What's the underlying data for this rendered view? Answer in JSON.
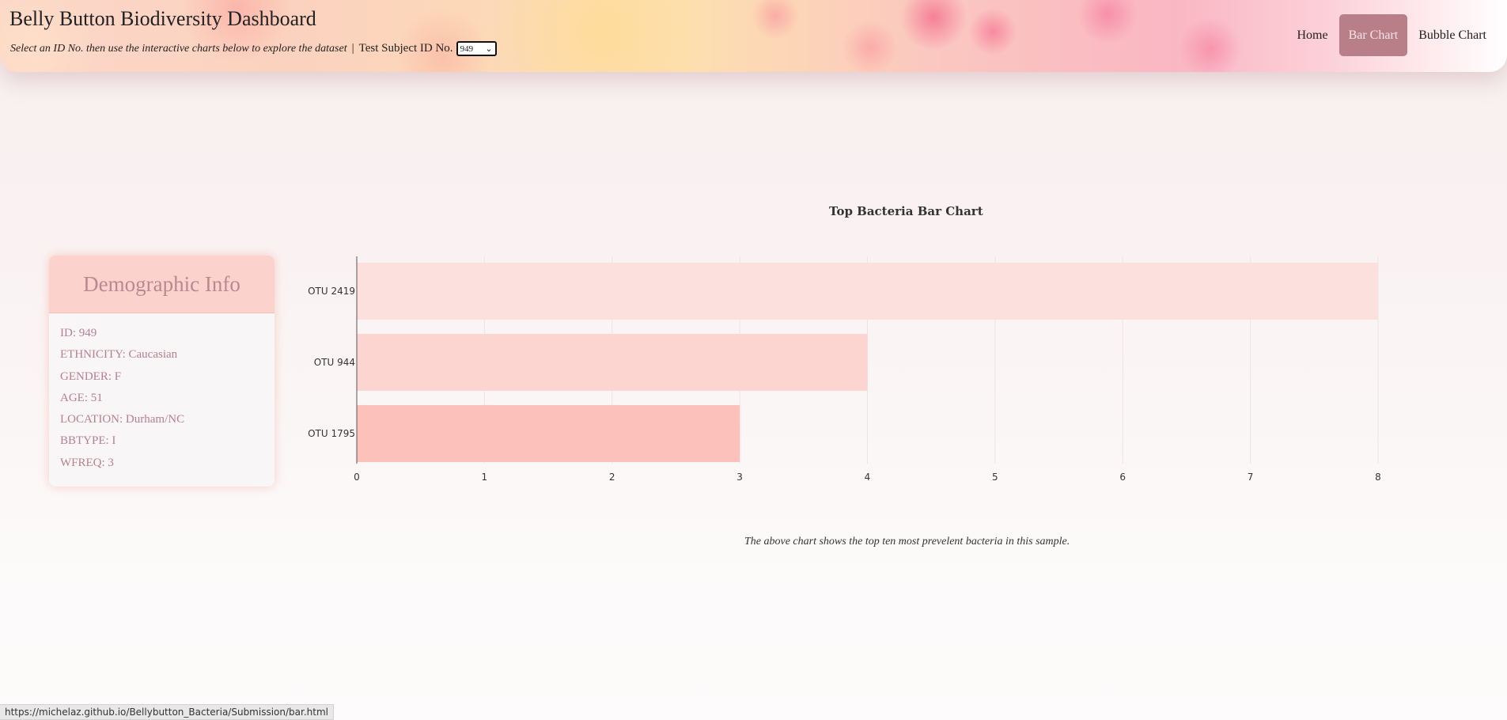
{
  "header": {
    "title": "Belly Button Biodiversity Dashboard",
    "instructions": "Select an ID No. then use the interactive charts below to explore the dataset",
    "separator": "|",
    "id_label": "Test Subject ID No.",
    "selected_id": "949"
  },
  "nav": {
    "items": [
      {
        "label": "Home",
        "active": false
      },
      {
        "label": "Bar Chart",
        "active": true
      },
      {
        "label": "Bubble Chart",
        "active": false
      }
    ]
  },
  "demographics": {
    "title": "Demographic Info",
    "lines": [
      "ID: 949",
      "ETHNICITY: Caucasian",
      "GENDER: F",
      "AGE: 51",
      "LOCATION: Durham/NC",
      "BBTYPE: I",
      "WFREQ: 3"
    ]
  },
  "chart_data": {
    "type": "bar",
    "orientation": "horizontal",
    "title": "Top Bacteria Bar Chart",
    "categories": [
      "OTU 2419",
      "OTU 944",
      "OTU 1795"
    ],
    "values": [
      8,
      4,
      3
    ],
    "colors": [
      "#fbe0dd",
      "#fcd5d0",
      "#fcc1bb"
    ],
    "xlim": [
      0,
      8
    ],
    "xticks": [
      0,
      1,
      2,
      3,
      4,
      5,
      6,
      7,
      8
    ],
    "grid": true
  },
  "caption": "The above chart shows the top ten most prevelent bacteria in this sample.",
  "status_bar": "https://michelaz.github.io/Bellybutton_Bacteria/Submission/bar.html",
  "colors": {
    "accent": "#b97f89",
    "panel_header": "#fcd3cc",
    "demo_text": "#b97f8d"
  }
}
